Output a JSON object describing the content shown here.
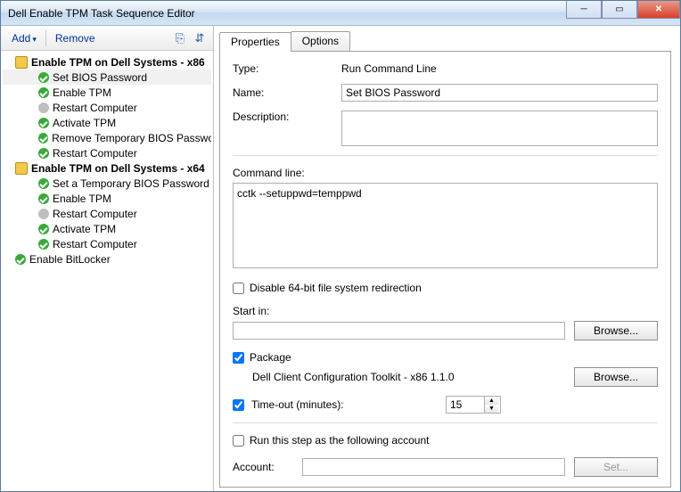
{
  "window": {
    "title": "Dell Enable TPM Task Sequence Editor"
  },
  "toolbar": {
    "add": "Add",
    "remove": "Remove"
  },
  "tree": [
    {
      "lvl": 1,
      "icon": "sys",
      "bold": true,
      "label": "Enable TPM on Dell Systems - x86"
    },
    {
      "lvl": 2,
      "icon": "ok",
      "bold": false,
      "label": "Set BIOS Password",
      "selected": true
    },
    {
      "lvl": 2,
      "icon": "ok",
      "bold": false,
      "label": "Enable TPM"
    },
    {
      "lvl": 2,
      "icon": "off",
      "bold": false,
      "label": "Restart Computer"
    },
    {
      "lvl": 2,
      "icon": "ok",
      "bold": false,
      "label": "Activate TPM"
    },
    {
      "lvl": 2,
      "icon": "ok",
      "bold": false,
      "label": "Remove Temporary BIOS Password"
    },
    {
      "lvl": 2,
      "icon": "ok",
      "bold": false,
      "label": "Restart Computer"
    },
    {
      "lvl": 1,
      "icon": "sys",
      "bold": true,
      "label": "Enable TPM on Dell Systems - x64"
    },
    {
      "lvl": 2,
      "icon": "ok",
      "bold": false,
      "label": "Set a Temporary BIOS Password"
    },
    {
      "lvl": 2,
      "icon": "ok",
      "bold": false,
      "label": "Enable TPM"
    },
    {
      "lvl": 2,
      "icon": "off",
      "bold": false,
      "label": "Restart Computer"
    },
    {
      "lvl": 2,
      "icon": "ok",
      "bold": false,
      "label": "Activate TPM"
    },
    {
      "lvl": 2,
      "icon": "ok",
      "bold": false,
      "label": "Restart Computer"
    },
    {
      "lvl": 1,
      "icon": "ok",
      "bold": false,
      "label": "Enable BitLocker"
    }
  ],
  "tabs": {
    "properties": "Properties",
    "options": "Options"
  },
  "form": {
    "type_label": "Type:",
    "type_value": "Run Command Line",
    "name_label": "Name:",
    "name_value": "Set BIOS Password",
    "desc_label": "Description:",
    "desc_value": "",
    "cmd_label": "Command line:",
    "cmd_value": "cctk --setuppwd=temppwd",
    "disable_redir_label": "Disable 64-bit file system redirection",
    "disable_redir_checked": false,
    "startin_label": "Start in:",
    "startin_value": "",
    "browse1": "Browse...",
    "package_label": "Package",
    "package_checked": true,
    "package_value": "Dell Client Configuration Toolkit - x86 1.1.0",
    "browse2": "Browse...",
    "timeout_label": "Time-out (minutes):",
    "timeout_checked": true,
    "timeout_value": "15",
    "runas_label": "Run this step as the following account",
    "runas_checked": false,
    "account_label": "Account:",
    "account_value": "",
    "set_btn": "Set..."
  }
}
